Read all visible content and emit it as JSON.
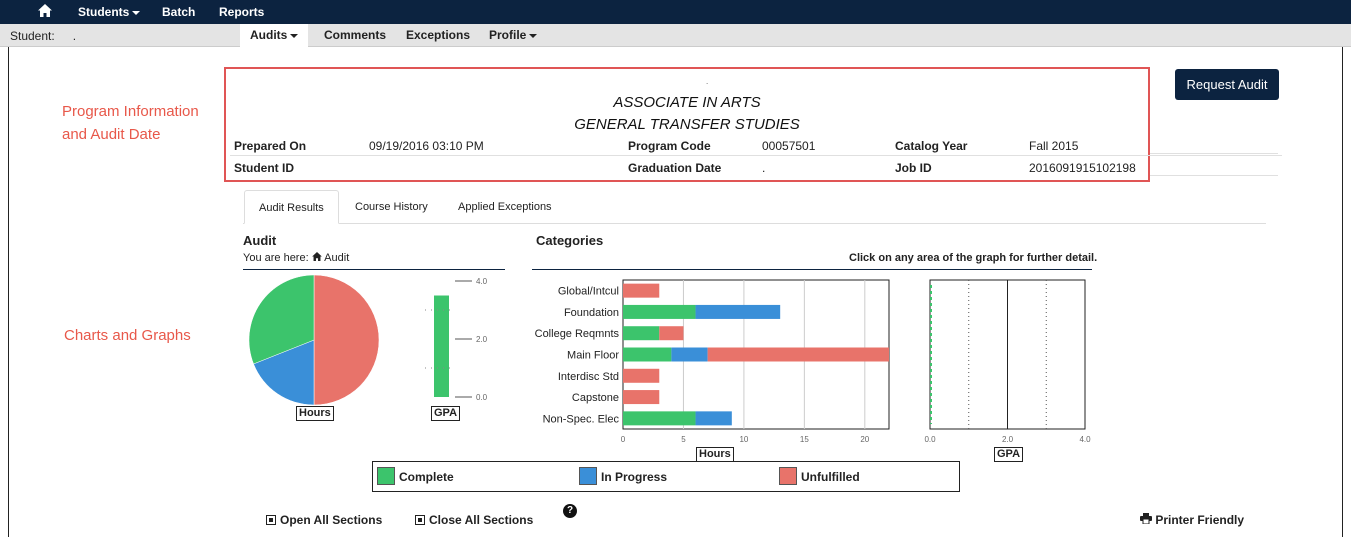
{
  "nav": {
    "home_icon": "home-icon",
    "items": [
      "Students",
      "Batch",
      "Reports"
    ]
  },
  "subnav": {
    "student_label": "Student:",
    "student_value": ".",
    "tabs": [
      "Audits",
      "Comments",
      "Exceptions",
      "Profile"
    ]
  },
  "annotations": {
    "program_info_line1": "Program Information",
    "program_info_line2": "and Audit Date",
    "charts": "Charts and Graphs"
  },
  "program": {
    "dot": ".",
    "title1": "ASSOCIATE IN ARTS",
    "title2": "GENERAL TRANSFER STUDIES",
    "prepared_on_label": "Prepared On",
    "prepared_on_value": "09/19/2016 03:10 PM",
    "program_code_label": "Program Code",
    "program_code_value": "00057501",
    "catalog_year_label": "Catalog Year",
    "catalog_year_value": "Fall 2015",
    "student_id_label": "Student ID",
    "graduation_date_label": "Graduation Date",
    "graduation_date_value": ".",
    "job_id_label": "Job ID",
    "job_id_value": "2016091915102198"
  },
  "request_audit": "Request Audit",
  "result_tabs": [
    "Audit Results",
    "Course History",
    "Applied Exceptions"
  ],
  "audit": {
    "title": "Audit",
    "breadcrumb_prefix": "You are here:",
    "breadcrumb_item": "Audit"
  },
  "categories": {
    "title": "Categories",
    "hint": "Click on any area of the graph for further detail."
  },
  "colors": {
    "complete": "#3cc46c",
    "in_progress": "#3a8fd8",
    "unfulfilled": "#e8736a"
  },
  "chart_data": [
    {
      "type": "pie",
      "xlabel": "Hours",
      "slices": [
        {
          "name": "Unfulfilled",
          "value": 50
        },
        {
          "name": "In Progress",
          "value": 19
        },
        {
          "name": "Complete",
          "value": 31
        }
      ]
    },
    {
      "type": "bar",
      "xlabel": "GPA",
      "ylim": [
        0,
        4
      ],
      "ticks": [
        "0.0",
        "2.0",
        "4.0"
      ],
      "values": [
        3.5
      ]
    },
    {
      "type": "bar",
      "orientation": "horizontal",
      "xlabel": "Hours",
      "xlim": [
        0,
        22
      ],
      "ticks": [
        0,
        5,
        10,
        15,
        20
      ],
      "categories": [
        "Global/Intcul",
        "Foundation",
        "College Reqmnts",
        "Main Floor",
        "Interdisc Std",
        "Capstone",
        "Non-Spec. Elec"
      ],
      "series": [
        {
          "name": "Complete",
          "values": [
            0,
            6,
            3,
            4,
            0,
            0,
            6
          ]
        },
        {
          "name": "In Progress",
          "values": [
            0,
            7,
            0,
            3,
            0,
            0,
            3
          ]
        },
        {
          "name": "Unfulfilled",
          "values": [
            3,
            0,
            2,
            15,
            3,
            3,
            0
          ]
        }
      ]
    },
    {
      "type": "bar",
      "orientation": "horizontal",
      "xlabel": "GPA",
      "xlim": [
        0,
        4
      ],
      "ticks": [
        "0.0",
        "2.0",
        "4.0"
      ]
    }
  ],
  "legend": [
    "Complete",
    "In Progress",
    "Unfulfilled"
  ],
  "footer": {
    "open_all": "Open All Sections",
    "close_all": "Close All Sections",
    "help_icon": "question-icon",
    "printer": "Printer Friendly"
  }
}
